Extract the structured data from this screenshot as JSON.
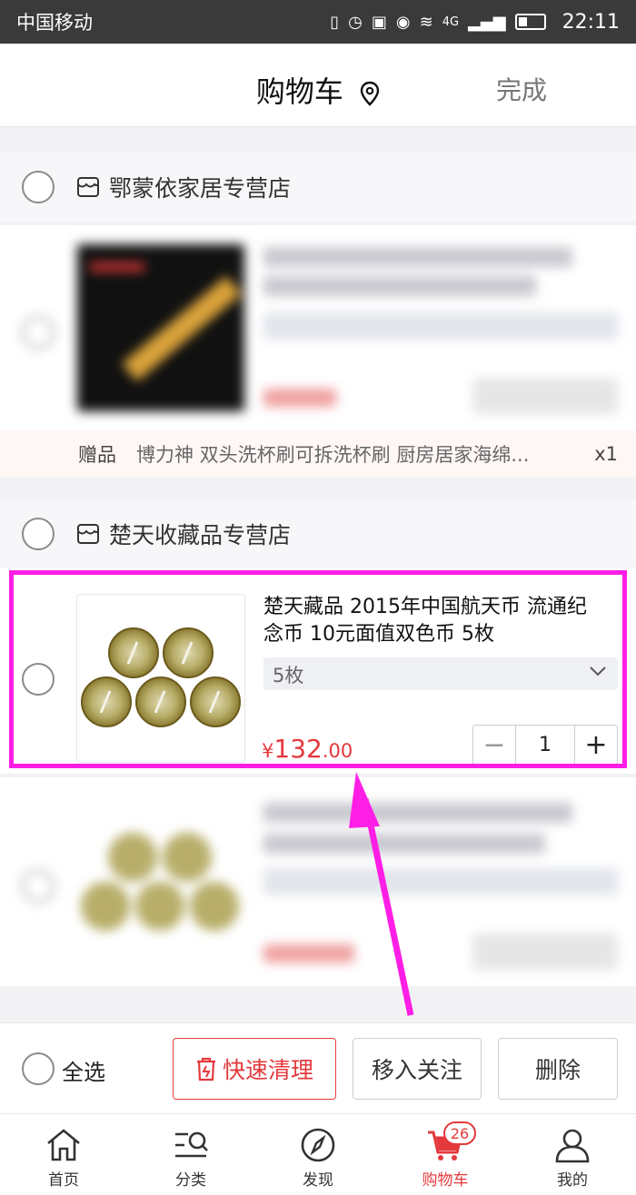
{
  "status_bar": {
    "carrier": "中国移动",
    "network": "4G",
    "time": "22:11"
  },
  "nav": {
    "title": "购物车",
    "done": "完成"
  },
  "shops": [
    {
      "name": "鄂蒙依家居专营店"
    },
    {
      "name": "楚天收藏品专营店"
    }
  ],
  "gift": {
    "label": "赠品",
    "text": "博力神 双头洗杯刷可拆洗杯刷 厨房居家海绵...",
    "count": "x1"
  },
  "item": {
    "title": "楚天藏品 2015年中国航天币 流通纪念币 10元面值双色币 5枚",
    "spec": "5枚",
    "price_symbol": "¥",
    "price_int": "132",
    "price_dec": ".00",
    "qty": "1",
    "minus": "−",
    "plus": "+"
  },
  "bottom": {
    "select_all": "全选",
    "quick_clean": "快速清理",
    "move_follow": "移入关注",
    "delete": "删除"
  },
  "tabs": [
    {
      "label": "首页",
      "icon": "home-icon"
    },
    {
      "label": "分类",
      "icon": "category-icon"
    },
    {
      "label": "发现",
      "icon": "compass-icon"
    },
    {
      "label": "购物车",
      "icon": "cart-icon",
      "badge": "26",
      "active": true
    },
    {
      "label": "我的",
      "icon": "person-icon"
    }
  ],
  "colors": {
    "accent": "#e4393c",
    "highlight": "#ff1ee6"
  }
}
